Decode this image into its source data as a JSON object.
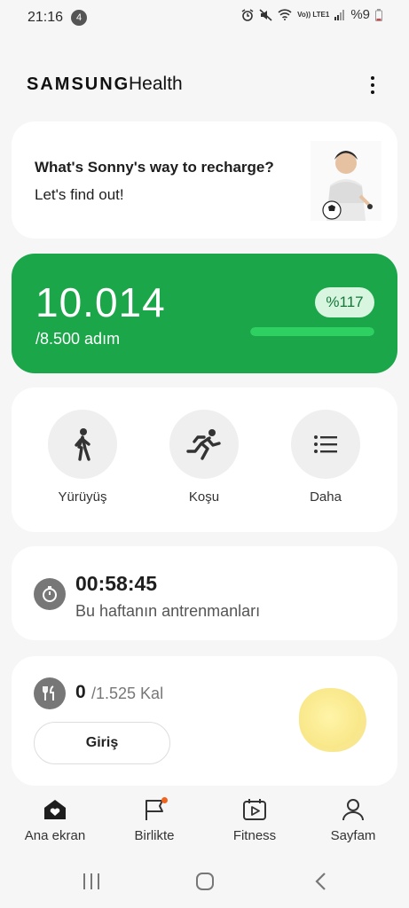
{
  "status": {
    "time": "21:16",
    "notification_count": "4",
    "network": "Vo)) LTE1",
    "battery": "%9"
  },
  "header": {
    "brand": "SAMSUNG",
    "app": "Health"
  },
  "promo": {
    "title": "What's Sonny's way to recharge?",
    "subtitle": "Let's find out!"
  },
  "steps": {
    "value": "10.014",
    "goal": "/8.500 adım",
    "percent": "%117",
    "progress": 1.0
  },
  "actions": [
    {
      "label": "Yürüyüş",
      "icon": "walk-icon"
    },
    {
      "label": "Koşu",
      "icon": "run-icon"
    },
    {
      "label": "Daha",
      "icon": "list-icon"
    }
  ],
  "workout": {
    "time": "00:58:45",
    "subtitle": "Bu haftanın antrenmanları"
  },
  "food": {
    "value": "0",
    "goal": "/1.525 Kal",
    "button": "Giriş"
  },
  "nav": [
    {
      "label": "Ana ekran",
      "icon": "home-heart-icon"
    },
    {
      "label": "Birlikte",
      "icon": "flag-icon"
    },
    {
      "label": "Fitness",
      "icon": "calendar-play-icon"
    },
    {
      "label": "Sayfam",
      "icon": "person-icon"
    }
  ],
  "colors": {
    "accent": "#1ba64a",
    "background": "#f6f6f6",
    "card": "#ffffff",
    "badge_dot": "#f0651e"
  }
}
